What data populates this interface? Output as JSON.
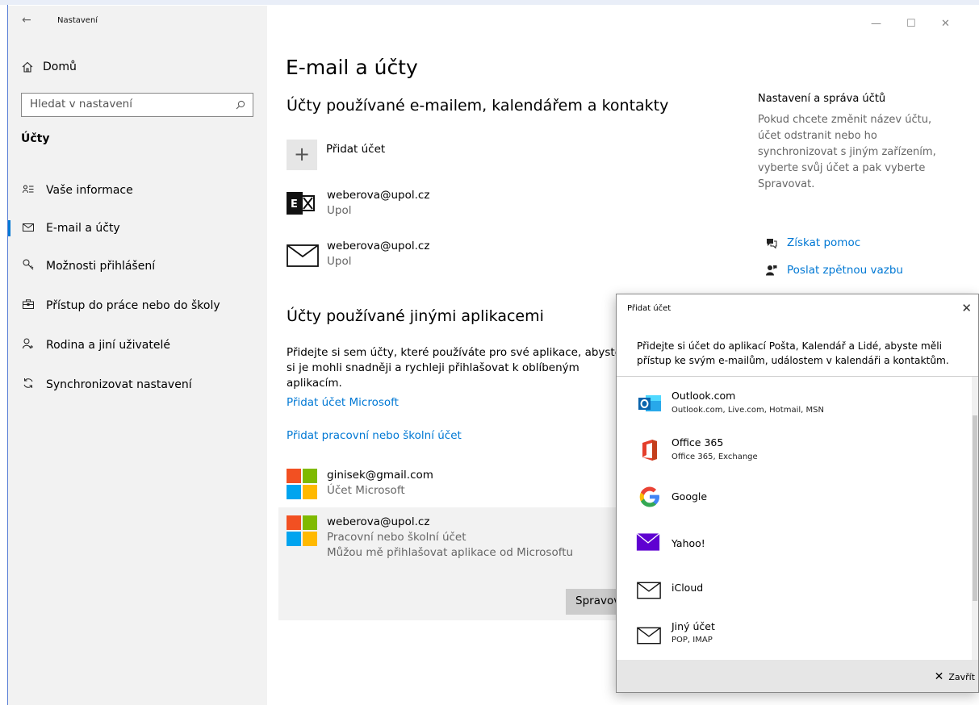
{
  "window": {
    "title": "Nastavení",
    "back_glyph": "←",
    "minimize_glyph": "—",
    "maximize_glyph": "☐",
    "close_glyph": "✕"
  },
  "sidebar": {
    "home_label": "Domů",
    "search_placeholder": "Hledat v nastavení",
    "section_title": "Účty",
    "items": [
      {
        "label": "Vaše informace",
        "icon": "user-card-icon"
      },
      {
        "label": "E-mail a účty",
        "icon": "mail-icon"
      },
      {
        "label": "Možnosti přihlášení",
        "icon": "key-icon"
      },
      {
        "label": "Přístup do práce nebo do školy",
        "icon": "briefcase-icon"
      },
      {
        "label": "Rodina a jiní uživatelé",
        "icon": "add-person-icon"
      },
      {
        "label": "Synchronizovat nastavení",
        "icon": "sync-icon"
      }
    ]
  },
  "main": {
    "title": "E-mail a účty",
    "email_section_title": "Účty používané e-mailem, kalendářem a kontakty",
    "add_account_label": "Přidat účet",
    "email_accounts": [
      {
        "email": "weberova@upol.cz",
        "provider": "Upol",
        "icon": "exchange-icon"
      },
      {
        "email": "weberova@upol.cz",
        "provider": "Upol",
        "icon": "mail-icon"
      }
    ],
    "other_apps_title": "Účty používané jinými aplikacemi",
    "other_apps_desc": "Přidejte si sem účty, které používáte pro své aplikace, abyste si je mohli snadněji a rychleji přihlašovat k oblíbeným aplikacím.",
    "add_microsoft_link": "Přidat účet Microsoft",
    "add_work_link": "Přidat pracovní nebo školní účet",
    "app_accounts": [
      {
        "email": "ginisek@gmail.com",
        "type": "Účet Microsoft"
      },
      {
        "email": "weberova@upol.cz",
        "type": "Pracovní nebo školní účet",
        "note": "Můžou mě přihlašovat aplikace od Microsoftu"
      }
    ],
    "manage_button": "Spravovat"
  },
  "right_panel": {
    "heading": "Nastavení a správa účtů",
    "text": "Pokud chcete změnit název účtu, účet odstranit nebo ho synchronizovat s jiným zařízením, vyberte svůj účet a pak vyberte Spravovat.",
    "help_link": "Získat pomoc",
    "feedback_link": "Poslat zpětnou vazbu"
  },
  "dialog": {
    "title": "Přidat účet",
    "description": "Přidejte si účet do aplikací Pošta, Kalendář a Lidé, abyste měli přístup ke svým e-mailům, událostem v kalendáři a kontaktům.",
    "providers": [
      {
        "name": "Outlook.com",
        "sub": "Outlook.com, Live.com, Hotmail, MSN",
        "icon": "outlook-icon"
      },
      {
        "name": "Office 365",
        "sub": "Office 365, Exchange",
        "icon": "office-icon"
      },
      {
        "name": "Google",
        "sub": "",
        "icon": "google-icon"
      },
      {
        "name": "Yahoo!",
        "sub": "",
        "icon": "yahoo-icon"
      },
      {
        "name": "iCloud",
        "sub": "",
        "icon": "mail-icon"
      },
      {
        "name": "Jiný účet",
        "sub": "POP, IMAP",
        "icon": "mail-icon"
      }
    ],
    "close_label": "Zavřít"
  },
  "colors": {
    "accent": "#0078d4",
    "sidebar_bg": "#f2f2f2",
    "yahoo": "#5f01d1"
  }
}
